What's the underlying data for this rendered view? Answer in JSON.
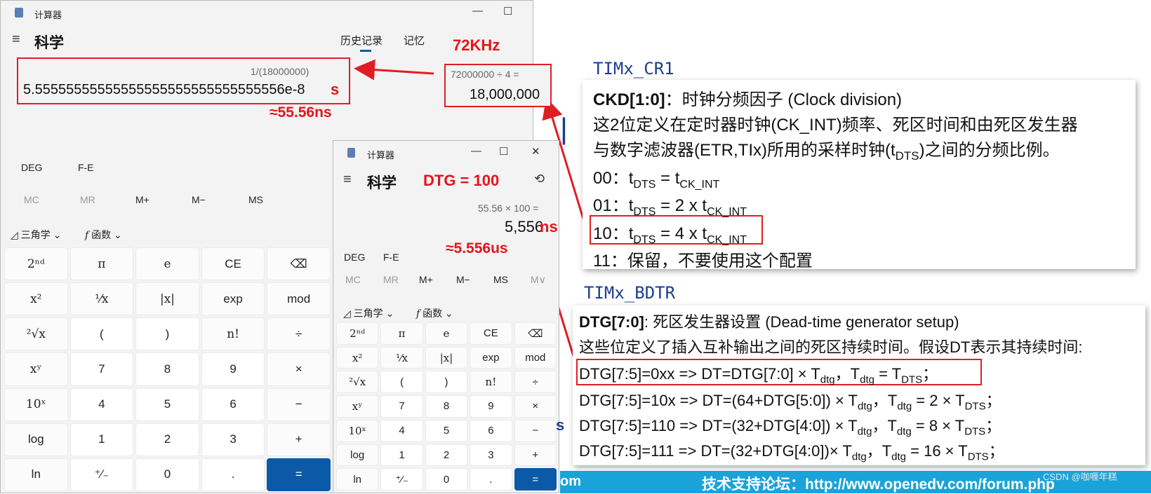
{
  "calc1": {
    "title": "计算器",
    "mode": "科学",
    "tabs": [
      "历史记录",
      "记忆"
    ],
    "expression": "1/(18000000)",
    "display": "5.55555555555555555555555555555556e-8",
    "unit": "s",
    "annotation": "≈55.56ns",
    "angle_mode": "DEG",
    "fe": "F-E",
    "mem": [
      "MC",
      "MR",
      "M+",
      "M−",
      "MS"
    ],
    "trig": "三角学",
    "func": "函数",
    "keys": [
      "2ⁿᵈ",
      "π",
      "e",
      "CE",
      "⌫",
      "x²",
      "¹⁄x",
      "|x|",
      "exp",
      "mod",
      "²√x",
      "(",
      ")",
      "n!",
      "÷",
      "xʸ",
      "7",
      "8",
      "9",
      "×",
      "10ˣ",
      "4",
      "5",
      "6",
      "−",
      "log",
      "1",
      "2",
      "3",
      "+",
      "ln",
      "⁺⁄₋",
      "0",
      ".",
      "="
    ]
  },
  "history_box": {
    "expression": "72000000 ÷ 4 =",
    "result": "18,000,000",
    "annotation": "72KHz"
  },
  "calc2": {
    "title": "计算器",
    "mode": "科学",
    "dtg_label": "DTG = 100",
    "expression": "55.56 × 100 =",
    "display": "5,556",
    "unit": "ns",
    "annotation": "≈5.556us",
    "angle_mode": "DEG",
    "fe": "F-E",
    "mem": [
      "MC",
      "MR",
      "M+",
      "M−",
      "MS",
      "M∨"
    ],
    "trig": "三角学",
    "func": "函数",
    "keys": [
      "2ⁿᵈ",
      "π",
      "e",
      "CE",
      "⌫",
      "x²",
      "¹⁄x",
      "|x|",
      "exp",
      "mod",
      "²√x",
      "(",
      ")",
      "n!",
      "÷",
      "xʸ",
      "7",
      "8",
      "9",
      "×",
      "10ˣ",
      "4",
      "5",
      "6",
      "−",
      "log",
      "1",
      "2",
      "3",
      "+",
      "ln",
      "⁺⁄₋",
      "0",
      ".",
      "="
    ]
  },
  "cr1": {
    "reg": "TIMx_CR1",
    "heading_bold": "CKD[1:0]",
    "heading_rest": "：时钟分频因子 (Clock division)",
    "line1": "这2位定义在定时器时钟(CK_INT)频率、死区时间和由死区发生器",
    "line2a": "与数字滤波器(ETR,TIx)所用的采样时钟(t",
    "line2sub": "DTS",
    "line2b": ")之间的分频比例。",
    "opt00": "00：t",
    "opt01a": "01：t",
    "opt10a": "10：t",
    "dts": "DTS",
    "eq1": " = t",
    "eq2": " = 2 x t",
    "eq4": " = 4 x t",
    "ckint": "CK_INT",
    "opt11": "11：保留，不要使用这个配置"
  },
  "bdtr": {
    "reg": "TIMx_BDTR",
    "heading_bold": "DTG[7:0]",
    "heading_rest": ": 死区发生器设置 (Dead-time generator setup)",
    "desc": "这些位定义了插入互补输出之间的死区持续时间。假设DT表示其持续时间:",
    "r1a": "DTG[7:5]=0xx => DT=DTG[7:0] × T",
    "r1b": "，T",
    "r1c": " = T",
    "r2a": "DTG[7:5]=10x => DT=(64+DTG[5:0]) × T",
    "r2c": " = 2 × T",
    "r3a": "DTG[7:5]=110 => DT=(32+DTG[4:0]) × T",
    "r3c": " = 8 × T",
    "r4a": "DTG[7:5]=111 => DT=(32+DTG[4:0])× T",
    "r4c": " = 16 × T",
    "dtg": "dtg",
    "dts": "DTS",
    "semi": "；"
  },
  "footer": {
    "text": "技术支持论坛：http://www.openedv.com/forum.php",
    "left_fragment": "om",
    "watermark": "CSDN @咖喱年糕"
  },
  "colors": {
    "accent": "#e11d24",
    "equals": "#0a5aa8",
    "footer": "#1aa3d8"
  }
}
